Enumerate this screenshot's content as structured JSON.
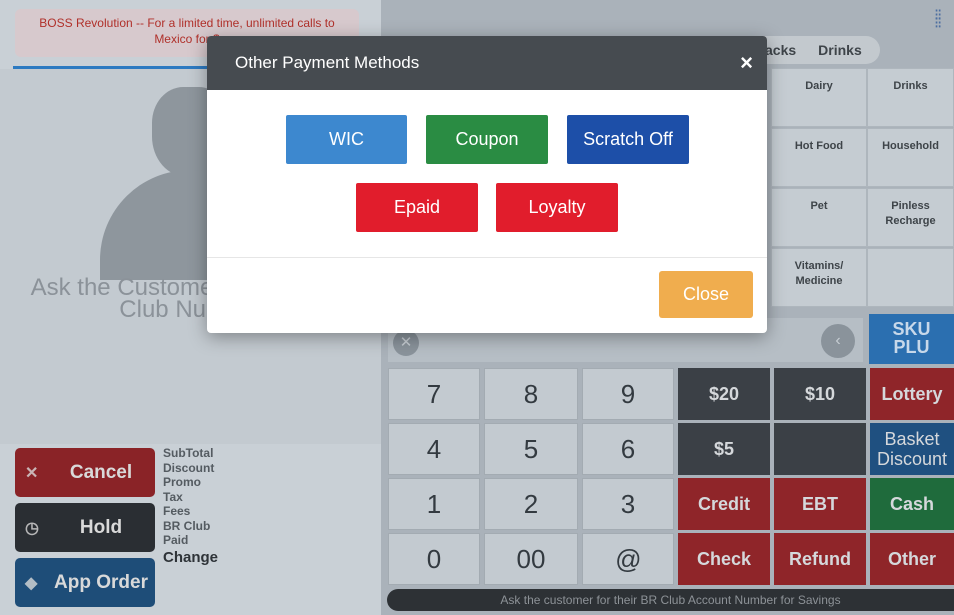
{
  "promo": {
    "text": "BOSS Revolution -- For a limited time, unlimited calls to Mexico for $"
  },
  "customer": {
    "prompt": "Ask the Customer for their BR Club Number"
  },
  "actions": {
    "cancel": "Cancel",
    "hold": "Hold",
    "app_order": "App Order"
  },
  "totals": {
    "labels": [
      "SubTotal",
      "Discount",
      "Promo",
      "Tax",
      "Fees",
      "BR Club",
      "Paid"
    ],
    "change": "Change"
  },
  "categories": {
    "tabs": [
      "acks",
      "Drinks"
    ],
    "items": [
      "Dairy",
      "Drinks",
      "Hot Food",
      "Household",
      "Pet",
      "Pinless Recharge",
      "Vitamins/ Medicine"
    ]
  },
  "sku": {
    "line1": "SKU",
    "line2": "PLU"
  },
  "keypad": {
    "keys": [
      "7",
      "8",
      "9",
      "4",
      "5",
      "6",
      "1",
      "2",
      "3",
      "0",
      "00",
      "@"
    ]
  },
  "function_keys": {
    "twenty": "$20",
    "ten": "$10",
    "lottery": "Lottery",
    "five": "$5",
    "basket_line1": "Basket",
    "basket_line2": "Discount",
    "credit": "Credit",
    "ebt": "EBT",
    "cash": "Cash",
    "check": "Check",
    "refund": "Refund",
    "other": "Other"
  },
  "footer": {
    "text": "Ask the customer for their BR Club Account Number for Savings"
  },
  "modal": {
    "title": "Other Payment Methods",
    "close_icon": "×",
    "buttons": {
      "wic": "WIC",
      "coupon": "Coupon",
      "scratch_off": "Scratch Off",
      "epaid": "Epaid",
      "loyalty": "Loyalty"
    },
    "close_label": "Close"
  },
  "colors": {
    "wic": "#3d88cf",
    "coupon": "#2a8c43",
    "scratch_off": "#1d4fa8",
    "epaid": "#e11d2c",
    "loyalty": "#e11d2c",
    "close": "#f0ad4e",
    "modal_header": "#464b50"
  }
}
